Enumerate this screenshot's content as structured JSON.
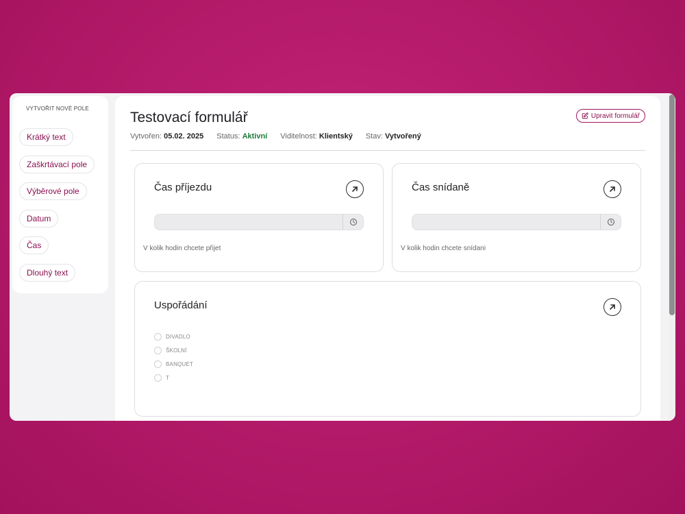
{
  "sidebar": {
    "title": "VYTVOŘIT NOVÉ POLE",
    "items": [
      {
        "label": "Krátký text"
      },
      {
        "label": "Zaškrtávací pole"
      },
      {
        "label": "Výběrové pole"
      },
      {
        "label": "Datum"
      },
      {
        "label": "Čas"
      },
      {
        "label": "Dlouhý text"
      }
    ]
  },
  "header": {
    "title": "Testovací formulář",
    "edit_label": "Upravit formulář",
    "meta": {
      "created_label": "Vytvořen:",
      "created_value": "05.02. 2025",
      "status_label": "Status:",
      "status_value": "Aktivní",
      "visibility_label": "Viditelnost:",
      "visibility_value": "Klientský",
      "state_label": "Stav:",
      "state_value": "Vytvořený"
    }
  },
  "cards": [
    {
      "title": "Čas příjezdu",
      "hint": "V kolik hodin chcete přijet",
      "value": ""
    },
    {
      "title": "Čas snídaně",
      "hint": "V kolik hodin chcete snídani",
      "value": ""
    },
    {
      "title": "Uspořádání",
      "options": [
        "DIVADLO",
        "ŠKOLNÍ",
        "BANQUET",
        "T"
      ]
    }
  ],
  "colors": {
    "accent": "#8a0f4f",
    "background": "#b4186a",
    "status_active": "#1d7a3a"
  },
  "icons": {
    "edit": "edit-icon",
    "arrow": "arrow-up-right-icon",
    "clock": "clock-icon"
  }
}
